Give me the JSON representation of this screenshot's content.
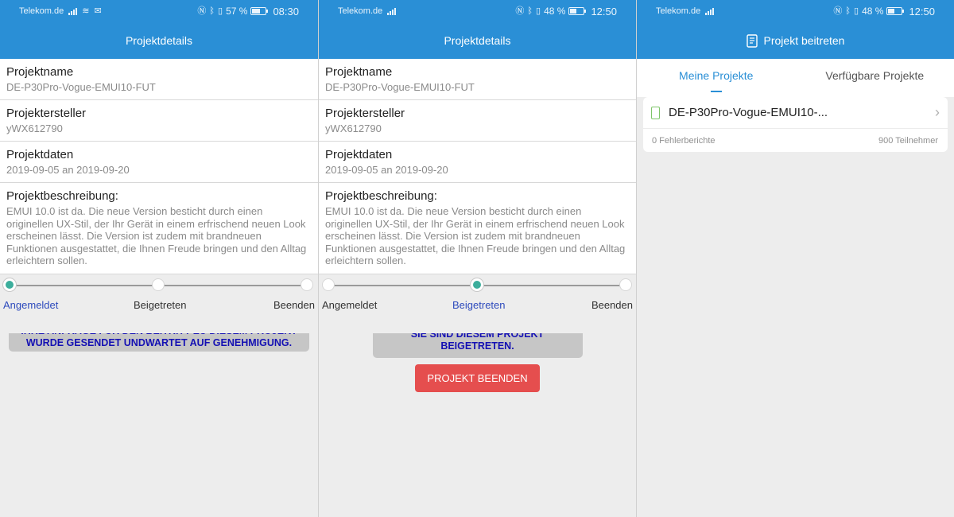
{
  "screens": [
    {
      "status": {
        "carrier": "Telekom.de",
        "battery": "57 %",
        "time": "08:30",
        "battery_level": 0.57
      },
      "title": "Projektdetails",
      "fields": [
        {
          "label": "Projektname",
          "value": "DE-P30Pro-Vogue-EMUI10-FUT"
        },
        {
          "label": "Projektersteller",
          "value": "yWX612790"
        },
        {
          "label": "Projektdaten",
          "value": "2019-09-05 an 2019-09-20"
        },
        {
          "label": "Projektbeschreibung:",
          "value": "EMUI 10.0 ist da. Die neue Version besticht durch einen originellen UX-Stil, der Ihr Gerät in einem erfrischend neuen Look erscheinen lässt. Die Version ist zudem mit brandneuen Funktionen ausgestattet, die Ihnen Freude bringen und den Alltag erleichtern sollen."
        }
      ],
      "steps": [
        "Angemeldet",
        "Beigetreten",
        "Beenden"
      ],
      "active_step": 0,
      "notice": "IHRE ANFRAGE FÜR DEN BEITRITT ZU DIESEM PROJEKT WURDE GESENDET UNDWARTET AUF GENEHMIGUNG."
    },
    {
      "status": {
        "carrier": "Telekom.de",
        "battery": "48 %",
        "time": "12:50",
        "battery_level": 0.48
      },
      "title": "Projektdetails",
      "fields": [
        {
          "label": "Projektname",
          "value": "DE-P30Pro-Vogue-EMUI10-FUT"
        },
        {
          "label": "Projektersteller",
          "value": "yWX612790"
        },
        {
          "label": "Projektdaten",
          "value": "2019-09-05 an 2019-09-20"
        },
        {
          "label": "Projektbeschreibung:",
          "value": "EMUI 10.0 ist da. Die neue Version besticht durch einen originellen UX-Stil, der Ihr Gerät in einem erfrischend neuen Look erscheinen lässt. Die Version ist zudem mit brandneuen Funktionen ausgestattet, die Ihnen Freude bringen und den Alltag erleichtern sollen."
        }
      ],
      "steps": [
        "Angemeldet",
        "Beigetreten",
        "Beenden"
      ],
      "active_step": 1,
      "notice": "SIE SIND DIESEM PROJEKT BEIGETRETEN.",
      "end_button": "PROJEKT BEENDEN"
    },
    {
      "status": {
        "carrier": "Telekom.de",
        "battery": "48 %",
        "time": "12:50",
        "battery_level": 0.48
      },
      "title": "Projekt beitreten",
      "tabs": [
        "Meine Projekte",
        "Verfügbare Projekte"
      ],
      "active_tab": 0,
      "project": {
        "name": "DE-P30Pro-Vogue-EMUI10-...",
        "reports": "0 Fehlerberichte",
        "participants": "900 Teilnehmer"
      }
    }
  ],
  "colors": {
    "header": "#2a8fd6",
    "accent_step": "#3cae9c",
    "notice_text": "#1410b3",
    "end_button": "#e54e4e"
  }
}
